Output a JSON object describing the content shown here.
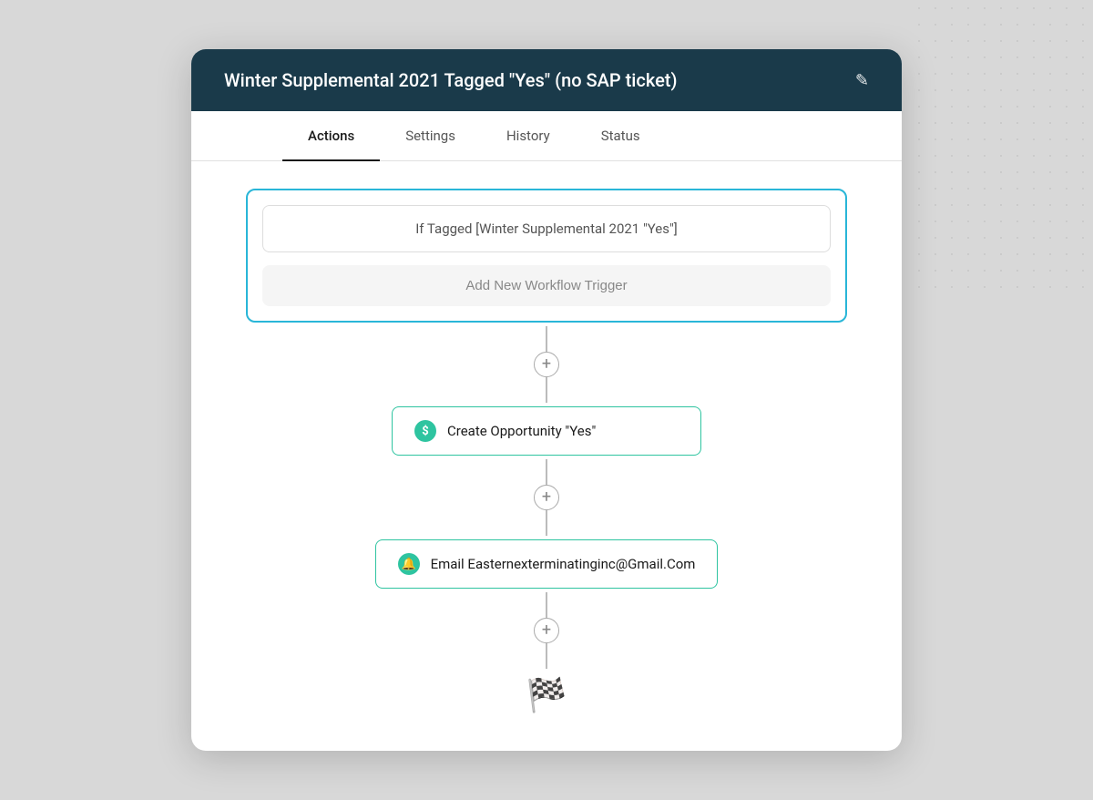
{
  "header": {
    "title": "Winter Supplemental 2021 Tagged \"Yes\" (no SAP ticket)",
    "edit_icon": "✎"
  },
  "tabs": [
    {
      "id": "actions",
      "label": "Actions",
      "active": true
    },
    {
      "id": "settings",
      "label": "Settings",
      "active": false
    },
    {
      "id": "history",
      "label": "History",
      "active": false
    },
    {
      "id": "status",
      "label": "Status",
      "active": false
    }
  ],
  "trigger": {
    "condition_text": "If Tagged [Winter Supplemental 2021 \"Yes\"]",
    "add_trigger_label": "Add New Workflow Trigger"
  },
  "actions": [
    {
      "id": "create-opportunity",
      "label": "Create Opportunity \"Yes\"",
      "icon_type": "dollar",
      "icon_text": "$"
    },
    {
      "id": "send-email",
      "label": "Email Easternexterminatinginc@Gmail.Com",
      "icon_type": "bell",
      "icon_text": "🔔"
    }
  ],
  "finish": {
    "icon": "🏁"
  },
  "add_step_symbol": "+",
  "colors": {
    "teal": "#29b6d8",
    "green": "#2ec4a0",
    "dark_header": "#1a3a4a"
  }
}
